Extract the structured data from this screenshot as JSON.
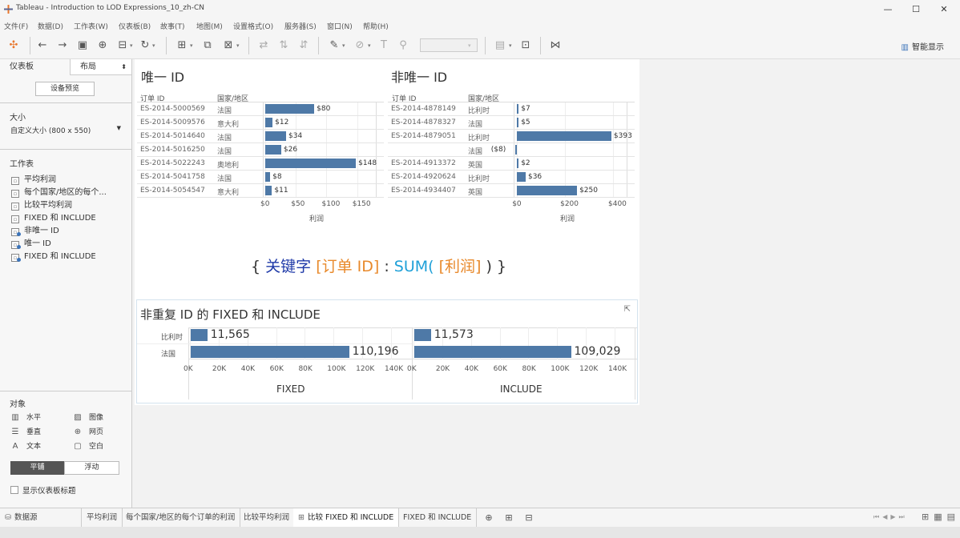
{
  "window": {
    "title": "Tableau - Introduction to LOD Expressions_10_zh-CN",
    "minimize": "—",
    "maximize": "☐",
    "close": "✕"
  },
  "menu": [
    "文件(F)",
    "数据(D)",
    "工作表(W)",
    "仪表板(B)",
    "故事(T)",
    "地图(M)",
    "设置格式(O)",
    "服务器(S)",
    "窗口(N)",
    "帮助(H)"
  ],
  "toolbar": {
    "smart_show": "智能显示"
  },
  "sidebar": {
    "tab_dashboard": "仪表板",
    "tab_layout": "布局",
    "device_preview": "设备预览",
    "size_title": "大小",
    "size_value": "自定义大小 (800 x 550)",
    "sheets_title": "工作表",
    "sheets": [
      "平均利润",
      "每个国家/地区的每个...",
      "比较平均利润",
      "FIXED 和 INCLUDE",
      "非唯一 ID",
      "唯一 ID",
      "FIXED 和 INCLUDE"
    ],
    "objects_title": "对象",
    "objects": {
      "horizontal": "水平",
      "image": "图像",
      "vertical": "垂直",
      "webpage": "网页",
      "text": "文本",
      "blank": "空白"
    },
    "tiled": "平铺",
    "floating": "浮动",
    "show_title": "显示仪表板标题"
  },
  "dashboard": {
    "unique": {
      "title": "唯一 ID",
      "col_order": "订单 ID",
      "col_country": "国家/地区",
      "rows": [
        {
          "id": "ES-2014-5000569",
          "country": "法国",
          "profit": 80,
          "label": "$80"
        },
        {
          "id": "ES-2014-5009576",
          "country": "意大利",
          "profit": 12,
          "label": "$12"
        },
        {
          "id": "ES-2014-5014640",
          "country": "法国",
          "profit": 34,
          "label": "$34"
        },
        {
          "id": "ES-2014-5016250",
          "country": "法国",
          "profit": 26,
          "label": "$26"
        },
        {
          "id": "ES-2014-5022243",
          "country": "奥地利",
          "profit": 148,
          "label": "$148"
        },
        {
          "id": "ES-2014-5041758",
          "country": "法国",
          "profit": 8,
          "label": "$8"
        },
        {
          "id": "ES-2014-5054547",
          "country": "意大利",
          "profit": 11,
          "label": "$11"
        }
      ],
      "ticks": [
        "$0",
        "$50",
        "$100",
        "$150"
      ],
      "axis_label": "利润"
    },
    "nonunique": {
      "title": "非唯一 ID",
      "col_order": "订单 ID",
      "col_country": "国家/地区",
      "rows": [
        {
          "id": "ES-2014-4878149",
          "country": "比利时",
          "profit": 7,
          "label": "$7"
        },
        {
          "id": "ES-2014-4878327",
          "country": "法国",
          "profit": 5,
          "label": "$5"
        },
        {
          "id": "ES-2014-4879051",
          "country": "比利时",
          "profit": 393,
          "label": "$393"
        },
        {
          "id": "",
          "country": "法国",
          "profit": -8,
          "label": "($8)"
        },
        {
          "id": "ES-2014-4913372",
          "country": "英国",
          "profit": 2,
          "label": "$2"
        },
        {
          "id": "ES-2014-4920624",
          "country": "比利时",
          "profit": 36,
          "label": "$36"
        },
        {
          "id": "ES-2014-4934407",
          "country": "英国",
          "profit": 250,
          "label": "$250"
        }
      ],
      "ticks": [
        "$0",
        "$200",
        "$400"
      ],
      "axis_label": "利润"
    },
    "formula": {
      "open": "{ ",
      "keyword": "关键字",
      "dim": " [订单 ID]",
      "colon": " : ",
      "func": "SUM(",
      "measure": " [利润]",
      "close": " ) }"
    },
    "fixed_include": {
      "title": "非重复 ID 的 FIXED 和 INCLUDE",
      "categories": [
        "比利时",
        "法国"
      ],
      "fixed_values": [
        11565,
        110196
      ],
      "fixed_labels": [
        "11,565",
        "110,196"
      ],
      "include_values": [
        11573,
        109029
      ],
      "include_labels": [
        "11,573",
        "109,029"
      ],
      "ticks": [
        "0K",
        "20K",
        "40K",
        "60K",
        "80K",
        "100K",
        "120K",
        "140K"
      ],
      "fixed_axis": "FIXED",
      "include_axis": "INCLUDE"
    }
  },
  "colors": {
    "bar": "#4e79a7",
    "keyword": "#1f3aa8",
    "field": "#e8892b",
    "function": "#1fa0d8"
  },
  "tabs": [
    "数据源",
    "平均利润",
    "每个国家/地区的每个订单的利润",
    "比较平均利润",
    "比较 FIXED 和 INCLUDE",
    "FIXED 和 INCLUDE"
  ],
  "chart_data": [
    {
      "type": "bar",
      "title": "唯一 ID",
      "categories": [
        "ES-2014-5000569",
        "ES-2014-5009576",
        "ES-2014-5014640",
        "ES-2014-5016250",
        "ES-2014-5022243",
        "ES-2014-5041758",
        "ES-2014-5054547"
      ],
      "values": [
        80,
        12,
        34,
        26,
        148,
        8,
        11
      ],
      "xlabel": "利润",
      "xlim": [
        0,
        170
      ]
    },
    {
      "type": "bar",
      "title": "非唯一 ID",
      "categories": [
        "ES-2014-4878149",
        "ES-2014-4878327",
        "ES-2014-4879051 (比利时)",
        "ES-2014-4879051 (法国)",
        "ES-2014-4913372",
        "ES-2014-4920624",
        "ES-2014-4934407"
      ],
      "values": [
        7,
        5,
        393,
        -8,
        2,
        36,
        250
      ],
      "xlabel": "利润",
      "xlim": [
        -40,
        460
      ]
    },
    {
      "type": "bar",
      "title": "非重复 ID 的 FIXED 和 INCLUDE",
      "categories": [
        "比利时",
        "法国"
      ],
      "series": [
        {
          "name": "FIXED",
          "values": [
            11565,
            110196
          ]
        },
        {
          "name": "INCLUDE",
          "values": [
            11573,
            109029
          ]
        }
      ],
      "xlim": [
        0,
        145000
      ]
    }
  ]
}
